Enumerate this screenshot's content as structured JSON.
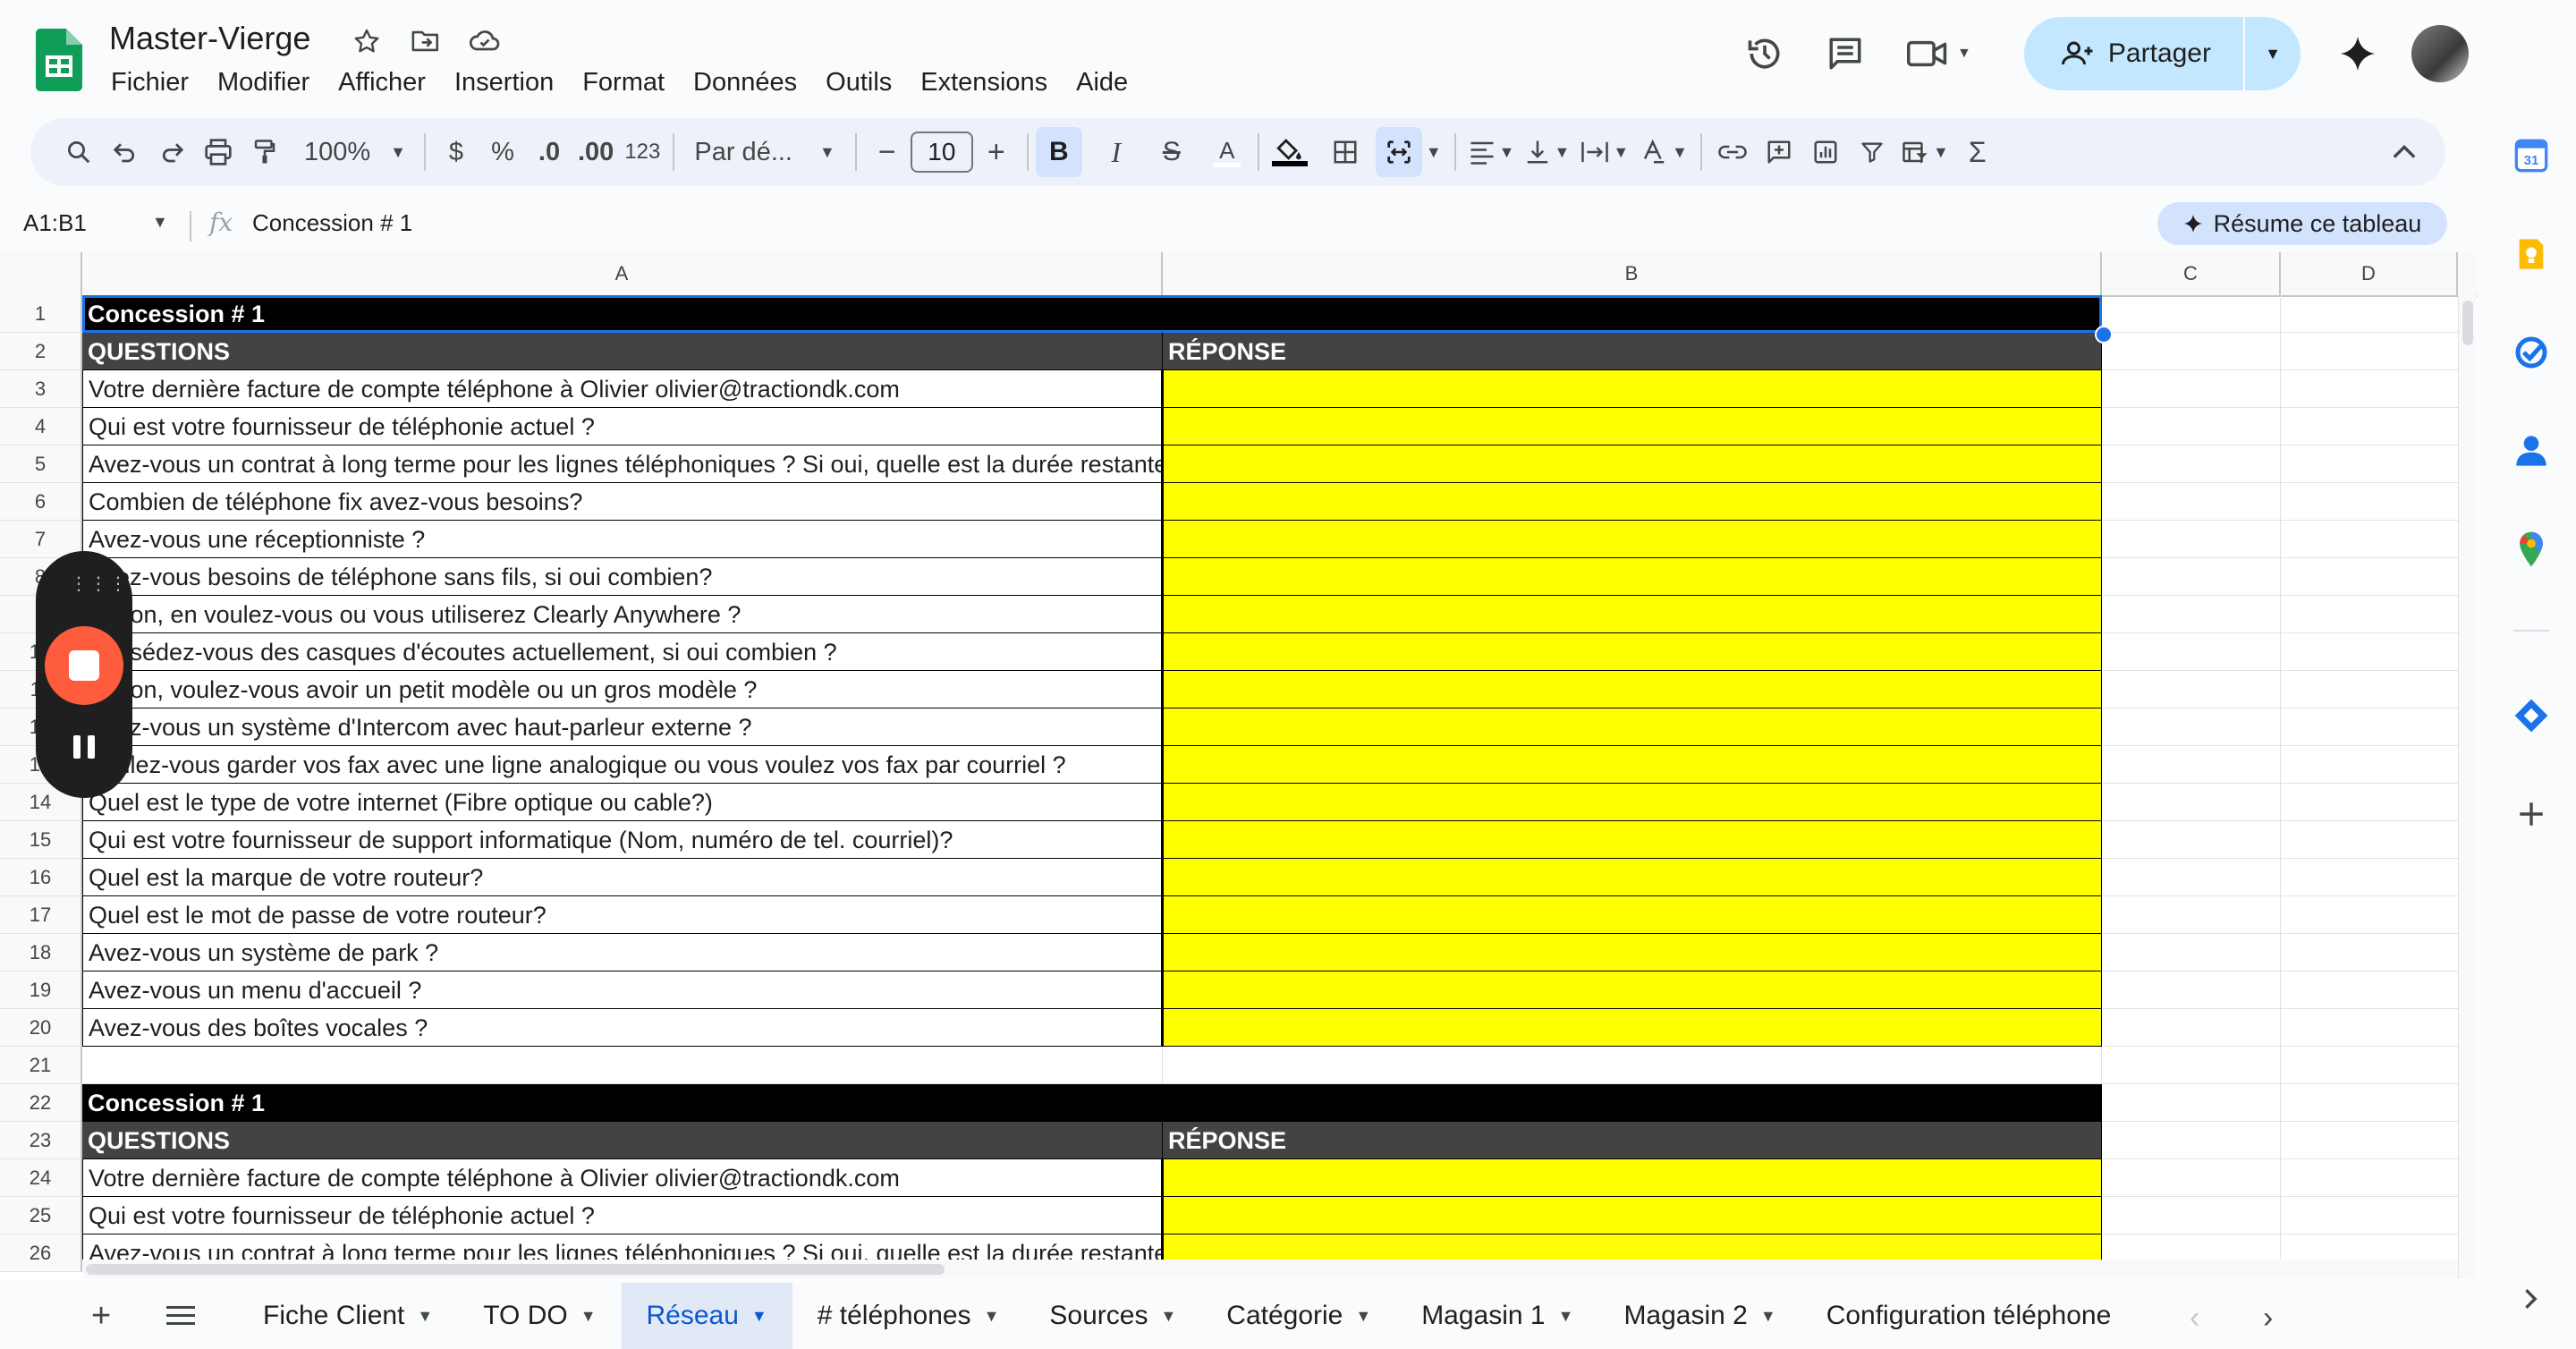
{
  "app": {
    "doc_title": "Master-Vierge",
    "menu": [
      "Fichier",
      "Modifier",
      "Afficher",
      "Insertion",
      "Format",
      "Données",
      "Outils",
      "Extensions",
      "Aide"
    ],
    "share_label": "Partager"
  },
  "toolbar": {
    "zoom": "100%",
    "currency": "$",
    "percent": "%",
    "dec_decrease": ".0",
    "dec_increase": ".00",
    "more_formats": "123",
    "font": "Par dé...",
    "font_size": "10",
    "bold": "B",
    "italic": "I",
    "strike": "S",
    "text_color": "A"
  },
  "formula_bar": {
    "name_box": "A1:B1",
    "fx": "fx",
    "value": "Concession # 1",
    "ai_summary": "Résume ce tableau"
  },
  "columns": [
    "A",
    "B",
    "C",
    "D"
  ],
  "rows": [
    {
      "n": "1",
      "type": "title",
      "a": "Concession # 1",
      "b": ""
    },
    {
      "n": "2",
      "type": "hdr",
      "a": "QUESTIONS",
      "b": "RÉPONSE"
    },
    {
      "n": "3",
      "type": "q",
      "a": "Votre dernière facture de compte téléphone à Olivier olivier@tractiondk.com",
      "b": ""
    },
    {
      "n": "4",
      "type": "q",
      "a": "Qui est votre fournisseur de téléphonie actuel ?",
      "b": ""
    },
    {
      "n": "5",
      "type": "q",
      "a": "Avez-vous un contrat à long terme pour les lignes téléphoniques ? Si oui, quelle est la durée restante",
      "b": ""
    },
    {
      "n": "6",
      "type": "q",
      "a": "Combien de téléphone fix avez-vous besoins?",
      "b": ""
    },
    {
      "n": "7",
      "type": "q",
      "a": "Avez-vous une réceptionniste ?",
      "b": ""
    },
    {
      "n": "8",
      "type": "q",
      "a": "Avez-vous besoins de téléphone sans fils, si oui combien?",
      "b": ""
    },
    {
      "n": "9",
      "type": "q",
      "a": "Si non, en voulez-vous ou vous utiliserez Clearly Anywhere ?",
      "b": ""
    },
    {
      "n": "10",
      "type": "q",
      "a": "Possédez-vous des casques d'écoutes actuellement, si oui combien ?",
      "b": ""
    },
    {
      "n": "11",
      "type": "q",
      "a": "Si non, voulez-vous avoir un petit modèle ou un gros modèle ?",
      "b": ""
    },
    {
      "n": "12",
      "type": "q",
      "a": "Avez-vous un système d'Intercom avec haut-parleur externe ?",
      "b": ""
    },
    {
      "n": "13",
      "type": "q",
      "a": "Voulez-vous garder vos fax avec une ligne analogique ou vous voulez vos fax par courriel ?",
      "b": ""
    },
    {
      "n": "14",
      "type": "q",
      "a": "Quel est le type de votre internet (Fibre optique ou cable?)",
      "b": ""
    },
    {
      "n": "15",
      "type": "q",
      "a": "Qui est votre fournisseur de support informatique (Nom, numéro de tel. courriel)?",
      "b": ""
    },
    {
      "n": "16",
      "type": "q",
      "a": "Quel est la marque de votre routeur?",
      "b": ""
    },
    {
      "n": "17",
      "type": "q",
      "a": "Quel est le mot de passe de votre routeur?",
      "b": ""
    },
    {
      "n": "18",
      "type": "q",
      "a": "Avez-vous un système de park ?",
      "b": ""
    },
    {
      "n": "19",
      "type": "q",
      "a": "Avez-vous un menu d'accueil ?",
      "b": ""
    },
    {
      "n": "20",
      "type": "q",
      "a": "Avez-vous des boîtes vocales ?",
      "b": ""
    },
    {
      "n": "21",
      "type": "empty",
      "a": "",
      "b": ""
    },
    {
      "n": "22",
      "type": "title",
      "a": "Concession # 1",
      "b": ""
    },
    {
      "n": "23",
      "type": "hdr",
      "a": "QUESTIONS",
      "b": "RÉPONSE"
    },
    {
      "n": "24",
      "type": "q",
      "a": "Votre dernière facture de compte téléphone à Olivier olivier@tractiondk.com",
      "b": ""
    },
    {
      "n": "25",
      "type": "q",
      "a": "Qui est votre fournisseur de téléphonie actuel ?",
      "b": ""
    },
    {
      "n": "26",
      "type": "q",
      "a": "Avez-vous un contrat à long terme pour les lignes téléphoniques ? Si oui, quelle est la durée restante",
      "b": ""
    }
  ],
  "sheet_tabs": [
    {
      "label": "Fiche Client",
      "active": false
    },
    {
      "label": "TO DO",
      "active": false
    },
    {
      "label": "Réseau",
      "active": true
    },
    {
      "label": "# téléphones",
      "active": false
    },
    {
      "label": "Sources",
      "active": false
    },
    {
      "label": "Catégorie",
      "active": false
    },
    {
      "label": "Magasin 1",
      "active": false
    },
    {
      "label": "Magasin 2",
      "active": false
    },
    {
      "label": "Configuration téléphone",
      "active": false
    }
  ],
  "colors": {
    "title_row_bg": "#000000",
    "header_row_bg": "#434343",
    "answer_cell_bg": "#ffff00",
    "share_button_bg": "#c2e7ff",
    "active_tab_text": "#0b57d0",
    "selection_border": "#1a73e8",
    "recorder_stop": "#ff5b3d"
  },
  "icons": {
    "side_panel": [
      "calendar-icon",
      "keep-icon",
      "tasks-icon",
      "contacts-icon",
      "maps-icon",
      "extension-icon",
      "add-icon",
      "expand-icon"
    ]
  }
}
